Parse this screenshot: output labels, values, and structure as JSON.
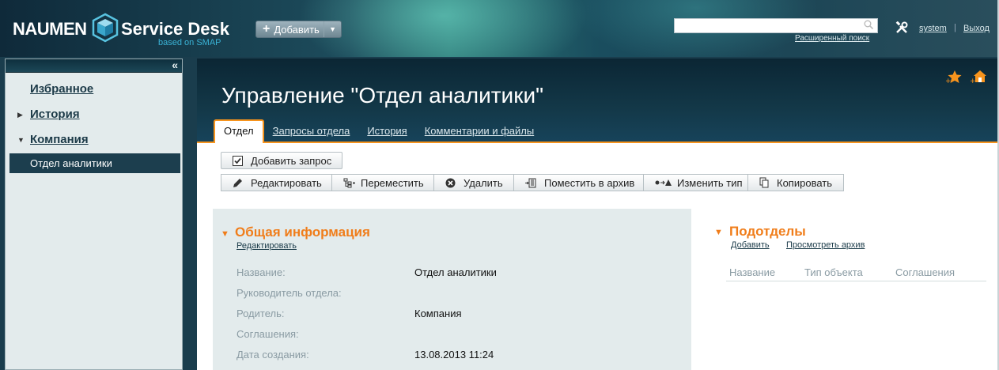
{
  "header": {
    "logo": {
      "brand": "NAUMEN",
      "product": "Service Desk",
      "sub": "based on SMAP"
    },
    "add_button": {
      "label": "Добавить"
    },
    "search": {
      "value": "",
      "placeholder": "",
      "advanced_link": "Расширенный поиск"
    },
    "user": "system",
    "separator": "|",
    "logout": "Выход"
  },
  "sidebar": {
    "collapse": "«",
    "items": [
      {
        "label": "Избранное",
        "expandable": false
      },
      {
        "label": "История",
        "expandable": true,
        "expanded": false
      },
      {
        "label": "Компания",
        "expandable": true,
        "expanded": true
      }
    ],
    "active_item": "Отдел аналитики"
  },
  "page": {
    "title": "Управление \"Отдел аналитики\"",
    "tabs": [
      {
        "label": "Отдел",
        "active": true
      },
      {
        "label": "Запросы отдела",
        "active": false
      },
      {
        "label": "История",
        "active": false
      },
      {
        "label": "Комментарии и файлы",
        "active": false
      }
    ]
  },
  "toolbar": {
    "add_request": "Добавить запрос",
    "actions": [
      {
        "label": "Редактировать",
        "icon": "pencil-icon"
      },
      {
        "label": "Переместить",
        "icon": "move-icon"
      },
      {
        "label": "Удалить",
        "icon": "delete-icon"
      },
      {
        "label": "Поместить в архив",
        "icon": "archive-icon"
      },
      {
        "label": "Изменить тип",
        "icon": "change-type-icon"
      },
      {
        "label": "Копировать",
        "icon": "copy-icon"
      }
    ]
  },
  "general_info": {
    "title": "Общая информация",
    "edit_link": "Редактировать",
    "fields": [
      {
        "label": "Название:",
        "value": "Отдел аналитики"
      },
      {
        "label": "Руководитель отдела:",
        "value": ""
      },
      {
        "label": "Родитель:",
        "value": "Компания"
      },
      {
        "label": "Соглашения:",
        "value": ""
      },
      {
        "label": "Дата создания:",
        "value": "13.08.2013 11:24"
      }
    ]
  },
  "subdivisions": {
    "title": "Подотделы",
    "add_link": "Добавить",
    "archive_link": "Просмотреть архив",
    "columns": [
      "Название",
      "Тип объекта",
      "Соглашения"
    ]
  },
  "colors": {
    "accent": "#f7941d",
    "section_title": "#f07d1a",
    "header_dark": "#0b2634",
    "panel_bg": "#e3ebec",
    "nav_active_bg": "#1c3e4e"
  }
}
